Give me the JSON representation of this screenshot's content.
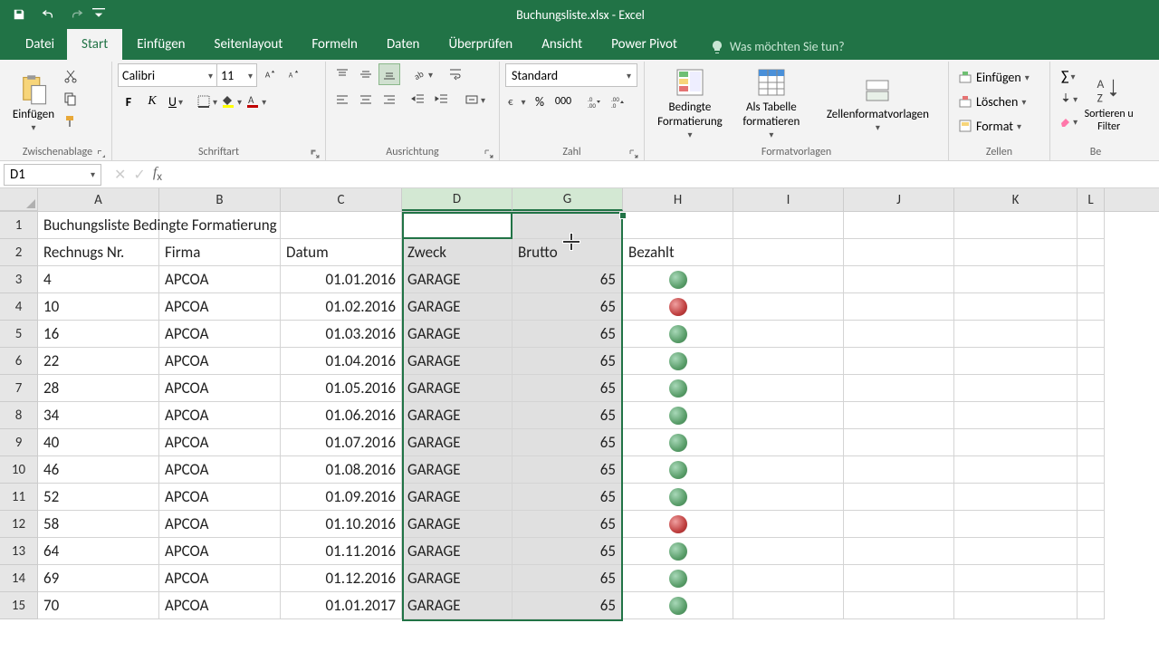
{
  "title": "Buchungsliste.xlsx - Excel",
  "tabs": {
    "file": "Datei",
    "start": "Start",
    "einfugen": "Einfügen",
    "seitenlayout": "Seitenlayout",
    "formeln": "Formeln",
    "daten": "Daten",
    "uberprufen": "Überprüfen",
    "ansicht": "Ansicht",
    "powerpivot": "Power Pivot"
  },
  "tellme": "Was möchten Sie tun?",
  "ribbon": {
    "clipboard": {
      "label": "Zwischenablage",
      "paste": "Einfügen"
    },
    "font": {
      "label": "Schriftart",
      "name": "Calibri",
      "size": "11"
    },
    "align": {
      "label": "Ausrichtung"
    },
    "number": {
      "label": "Zahl",
      "format": "Standard"
    },
    "styles": {
      "label": "Formatvorlagen",
      "cond": "Bedingte\nFormatierung",
      "table": "Als Tabelle\nformatieren",
      "cell": "Zellenformatvorlagen"
    },
    "cells": {
      "label": "Zellen",
      "insert": "Einfügen",
      "delete": "Löschen",
      "format": "Format"
    },
    "editing": {
      "label": "Be",
      "sort": "Sortieren u\nFilter"
    }
  },
  "namebox": "D1",
  "columns": [
    "A",
    "B",
    "C",
    "D",
    "G",
    "H",
    "I",
    "J",
    "K",
    "L"
  ],
  "selectedCols": [
    "D",
    "G"
  ],
  "headers": {
    "r1": "Buchungsliste Bedingte Formatierung",
    "A": "Rechnugs Nr.",
    "B": "Firma",
    "C": "Datum",
    "D": "Zweck",
    "G": "Brutto",
    "H": "Bezahlt"
  },
  "rows": [
    {
      "n": "3",
      "A": "4",
      "B": "APCOA",
      "C": "01.01.2016",
      "D": "GARAGE",
      "G": "65",
      "H": "green"
    },
    {
      "n": "4",
      "A": "10",
      "B": "APCOA",
      "C": "01.02.2016",
      "D": "GARAGE",
      "G": "65",
      "H": "red"
    },
    {
      "n": "5",
      "A": "16",
      "B": "APCOA",
      "C": "01.03.2016",
      "D": "GARAGE",
      "G": "65",
      "H": "green"
    },
    {
      "n": "6",
      "A": "22",
      "B": "APCOA",
      "C": "01.04.2016",
      "D": "GARAGE",
      "G": "65",
      "H": "green"
    },
    {
      "n": "7",
      "A": "28",
      "B": "APCOA",
      "C": "01.05.2016",
      "D": "GARAGE",
      "G": "65",
      "H": "green"
    },
    {
      "n": "8",
      "A": "34",
      "B": "APCOA",
      "C": "01.06.2016",
      "D": "GARAGE",
      "G": "65",
      "H": "green"
    },
    {
      "n": "9",
      "A": "40",
      "B": "APCOA",
      "C": "01.07.2016",
      "D": "GARAGE",
      "G": "65",
      "H": "green"
    },
    {
      "n": "10",
      "A": "46",
      "B": "APCOA",
      "C": "01.08.2016",
      "D": "GARAGE",
      "G": "65",
      "H": "green"
    },
    {
      "n": "11",
      "A": "52",
      "B": "APCOA",
      "C": "01.09.2016",
      "D": "GARAGE",
      "G": "65",
      "H": "green"
    },
    {
      "n": "12",
      "A": "58",
      "B": "APCOA",
      "C": "01.10.2016",
      "D": "GARAGE",
      "G": "65",
      "H": "red"
    },
    {
      "n": "13",
      "A": "64",
      "B": "APCOA",
      "C": "01.11.2016",
      "D": "GARAGE",
      "G": "65",
      "H": "green"
    },
    {
      "n": "14",
      "A": "69",
      "B": "APCOA",
      "C": "01.12.2016",
      "D": "GARAGE",
      "G": "65",
      "H": "green"
    },
    {
      "n": "15",
      "A": "70",
      "B": "APCOA",
      "C": "01.01.2017",
      "D": "GARAGE",
      "G": "65",
      "H": "green"
    }
  ]
}
